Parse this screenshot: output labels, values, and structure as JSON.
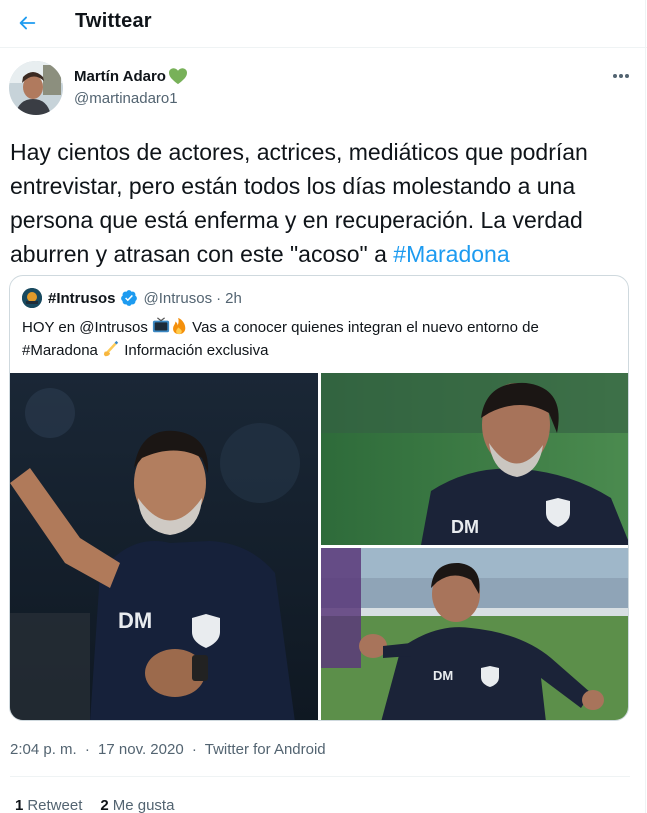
{
  "header": {
    "title": "Twittear"
  },
  "tweet": {
    "author": {
      "name": "Martín Adaro",
      "handle": "@martinadaro1"
    },
    "text": "Hay cientos de actores, actrices, mediáticos que podrían entrevistar, pero están todos los días molestando a una persona que está enferma y en recuperación. La verdad aburren y atrasan con este \"acoso\" a ",
    "hashtag": "#Maradona",
    "quote": {
      "name": "#Intrusos",
      "handle": "@Intrusos",
      "separator": "·",
      "time": "2h",
      "text_part1": "HOY en @Intrusos ",
      "text_part2": " Vas a conocer quienes integran el nuevo entorno de #Maradona ",
      "text_part3": " Información exclusiva"
    },
    "meta": {
      "time": "2:04 p. m.",
      "separator1": "·",
      "date": "17 nov. 2020",
      "separator2": "·",
      "source": "Twitter for Android"
    },
    "stats": {
      "retweets_count": "1",
      "retweets_label": "Retweet",
      "likes_count": "2",
      "likes_label": "Me gusta"
    }
  },
  "colors": {
    "accent": "#1d9bf0",
    "text": "#0f1419",
    "secondary": "#536471",
    "border": "#cfd9de",
    "heart": "#78b159"
  },
  "icons": [
    "back-arrow-icon",
    "green-heart-icon",
    "more-icon",
    "verified-icon",
    "tv-emoji-icon",
    "fire-emoji-icon",
    "writing-hand-emoji-icon"
  ]
}
